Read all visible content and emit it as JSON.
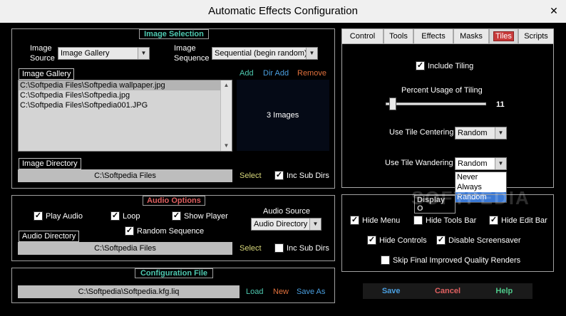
{
  "window": {
    "title": "Automatic Effects Configuration",
    "close_glyph": "✕"
  },
  "image_selection": {
    "legend": "Image Selection",
    "source_label_1": "Image",
    "source_label_2": "Source",
    "source_value": "Image Gallery",
    "sequence_label_1": "Image",
    "sequence_label_2": "Sequence",
    "sequence_value": "Sequential (begin random)",
    "gallery_label": "Image Gallery",
    "gallery_items": [
      "C:\\Softpedia Files\\Softpedia wallpaper.jpg",
      "C:\\Softpedia Files\\Softpedia.jpg",
      "C:\\Softpedia Files\\Softpedia001.JPG"
    ],
    "add": "Add",
    "dir_add": "Dir Add",
    "remove": "Remove",
    "count": "3 Images",
    "directory_label": "Image Directory",
    "directory_value": "C:\\Softpedia Files",
    "select": "Select",
    "inc_sub_dirs": "Inc Sub Dirs"
  },
  "audio_options": {
    "legend": "Audio Options",
    "play_audio": "Play Audio",
    "loop": "Loop",
    "show_player": "Show Player",
    "random_sequence": "Random Sequence",
    "source_label": "Audio Source",
    "source_value": "Audio Directory",
    "directory_label": "Audio Directory",
    "directory_value": "C:\\Softpedia Files",
    "select": "Select",
    "inc_sub_dirs": "Inc Sub Dirs"
  },
  "configuration_file": {
    "legend": "Configuration File",
    "path": "C:\\Softpedia\\Softpedia.kfg.liq",
    "load": "Load",
    "new": "New",
    "save_as": "Save As"
  },
  "tabs": [
    "Control",
    "Tools",
    "Effects",
    "Masks",
    "Tiles",
    "Scripts"
  ],
  "tiles": {
    "include_tiling": "Include Tiling",
    "percent_label": "Percent Usage of Tiling",
    "percent_value": "11",
    "centering_label": "Use Tile Centering",
    "centering_value": "Random",
    "wandering_label": "Use Tile Wandering",
    "wandering_value": "Random",
    "wandering_options": [
      "Never",
      "Always",
      "Random"
    ]
  },
  "display_options": {
    "legend": "Display O",
    "hide_menu": "Hide Menu",
    "hide_tools_bar": "Hide Tools Bar",
    "hide_edit_bar": "Hide Edit Bar",
    "hide_controls": "Hide Controls",
    "disable_screensaver": "Disable Screensaver",
    "skip_final": "Skip Final Improved Quality Renders"
  },
  "buttons": {
    "save": "Save",
    "cancel": "Cancel",
    "help": "Help"
  },
  "watermark": "SOFTPEDIA",
  "colors": {
    "teal": "#4ec9b0",
    "red": "#e06060",
    "blue": "#4a9fe0",
    "orange": "#e0703c",
    "help_green": "#4ec98a"
  }
}
